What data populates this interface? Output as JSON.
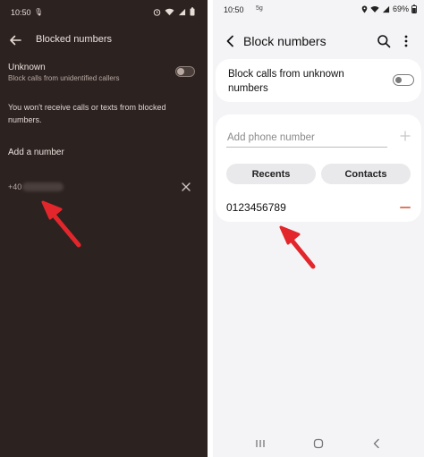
{
  "left_phone": {
    "status": {
      "time": "10:50",
      "mic_icon": "mic-icon",
      "right_icons": [
        "alarm-icon",
        "wifi-icon",
        "signal-icon",
        "battery-icon"
      ]
    },
    "header": {
      "back_icon": "arrow-left-icon",
      "title": "Blocked numbers"
    },
    "unknown": {
      "title": "Unknown",
      "subtitle": "Block calls from unidentified callers",
      "toggle_on": false
    },
    "notice": "You won't receive calls or texts from blocked numbers.",
    "add_label": "Add a number",
    "blocked_number_prefix": "+40",
    "remove_icon": "close-icon"
  },
  "right_phone": {
    "status": {
      "time": "10:50",
      "notification_icon": "5g-icon",
      "battery": "69%"
    },
    "header": {
      "back_icon": "chevron-left-icon",
      "title": "Block numbers",
      "search_icon": "search-icon",
      "more_icon": "more-vert-icon"
    },
    "unknown_toggle_label": "Block calls from unknown numbers",
    "unknown_toggle_on": false,
    "input_placeholder": "Add phone number",
    "add_icon": "plus-icon",
    "recents_label": "Recents",
    "contacts_label": "Contacts",
    "blocked_number": "0123456789",
    "remove_icon": "minus-icon",
    "nav": [
      "recents-nav-icon",
      "home-nav-icon",
      "back-nav-icon"
    ]
  },
  "colors": {
    "left_bg": "#2c2220",
    "right_bg": "#f4f4f6",
    "annotation_arrow": "#e3262b",
    "remove_accent": "#e07a5f"
  }
}
